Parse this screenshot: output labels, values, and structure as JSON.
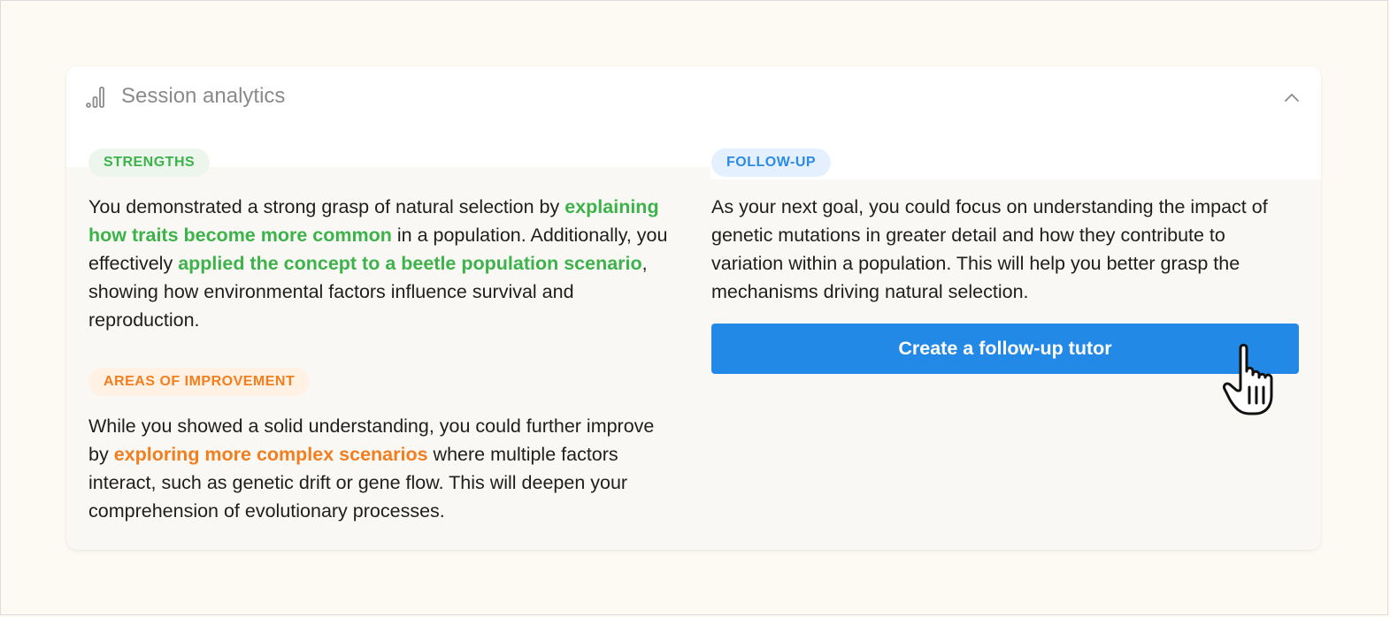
{
  "card": {
    "title": "Session analytics",
    "header_icon": "bar-chart-icon",
    "collapse_icon": "chevron-up-icon"
  },
  "strengths": {
    "badge": "STRENGTHS",
    "text_1": "You demonstrated a strong grasp of natural selection by ",
    "highlight_1": "explaining how traits become more common",
    "text_2": " in a population. Additionally, you effectively ",
    "highlight_2": "applied the concept to a beetle population scenario",
    "text_3": ", showing how environmental factors influence survival and reproduction."
  },
  "improvement": {
    "badge": "AREAS OF IMPROVEMENT",
    "text_1": "While you showed a solid understanding, you could further improve by ",
    "highlight_1": "exploring more complex scenarios",
    "text_2": " where multiple factors interact, such as genetic drift or gene flow. This will deepen your comprehension of evolutionary processes."
  },
  "followup": {
    "badge": "FOLLOW-UP",
    "text": "As your next goal, you could focus on understanding the impact of genetic mutations in greater detail and how they contribute to variation within a population. This will help you better grasp the mechanisms driving natural selection.",
    "button_label": "Create a follow-up tutor"
  },
  "cursor": {
    "icon": "pointer-hand-icon"
  },
  "colors": {
    "green": "#3cb34a",
    "orange": "#f27e1e",
    "blue": "#2389e6",
    "background": "#fdfaf3"
  }
}
